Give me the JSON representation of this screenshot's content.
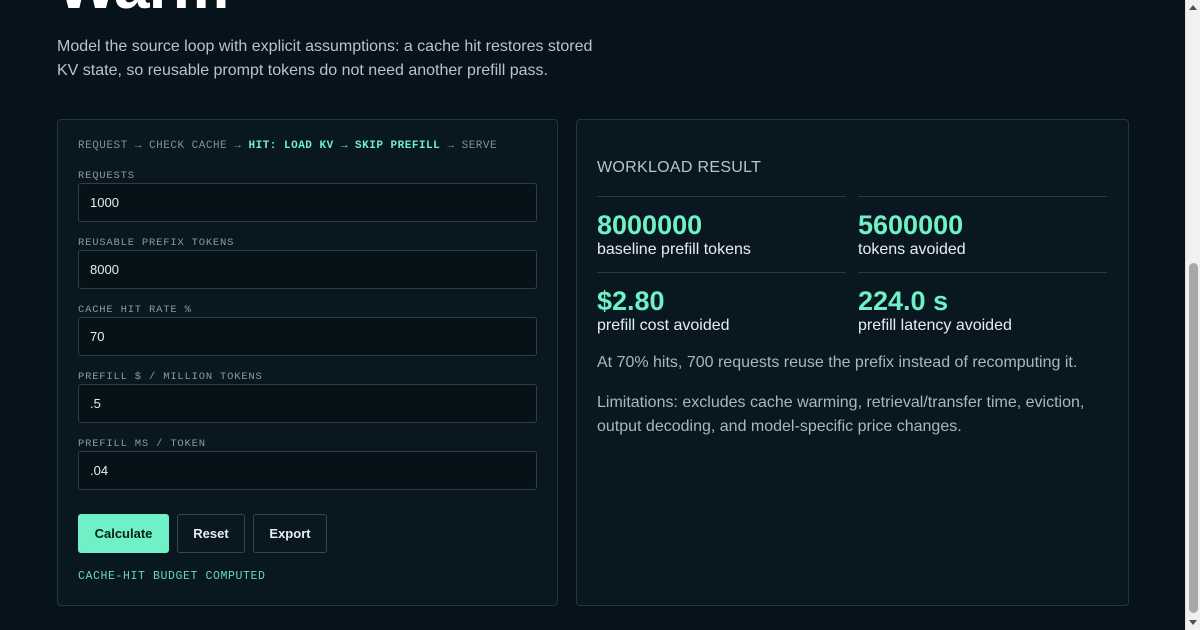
{
  "page": {
    "title": "Warm",
    "intro": "Model the source loop with explicit assumptions: a cache hit restores stored KV state, so reusable prompt tokens do not need another prefill pass."
  },
  "flow": {
    "step1": "REQUEST",
    "step2": "CHECK CACHE",
    "step3": "HIT: LOAD KV",
    "step4": "SKIP PREFILL",
    "step5": "SERVE",
    "arrow": "→"
  },
  "form": {
    "requests": {
      "label": "REQUESTS",
      "value": "1000"
    },
    "prefix_tokens": {
      "label": "REUSABLE PREFIX TOKENS",
      "value": "8000"
    },
    "hit_rate": {
      "label": "CACHE HIT RATE %",
      "value": "70"
    },
    "price": {
      "label": "PREFILL $ / MILLION TOKENS",
      "value": ".5"
    },
    "latency": {
      "label": "PREFILL MS / TOKEN",
      "value": ".04"
    }
  },
  "buttons": {
    "calculate": "Calculate",
    "reset": "Reset",
    "export": "Export"
  },
  "status": "CACHE-HIT BUDGET COMPUTED",
  "result": {
    "title": "WORKLOAD RESULT",
    "metrics": [
      {
        "value": "8000000",
        "label": "baseline prefill tokens"
      },
      {
        "value": "5600000",
        "label": "tokens avoided"
      },
      {
        "value": "$2.80",
        "label": "prefill cost avoided"
      },
      {
        "value": "224.0 s",
        "label": "prefill latency avoided"
      }
    ],
    "summary": "At 70% hits, 700 requests reuse the prefix instead of recomputing it.",
    "limitations": "Limitations: excludes cache warming, retrieval/transfer time, eviction, output decoding, and model-specific price changes."
  },
  "colors": {
    "background": "#07131b",
    "accent": "#6ff0c6",
    "panel": "#091820"
  }
}
